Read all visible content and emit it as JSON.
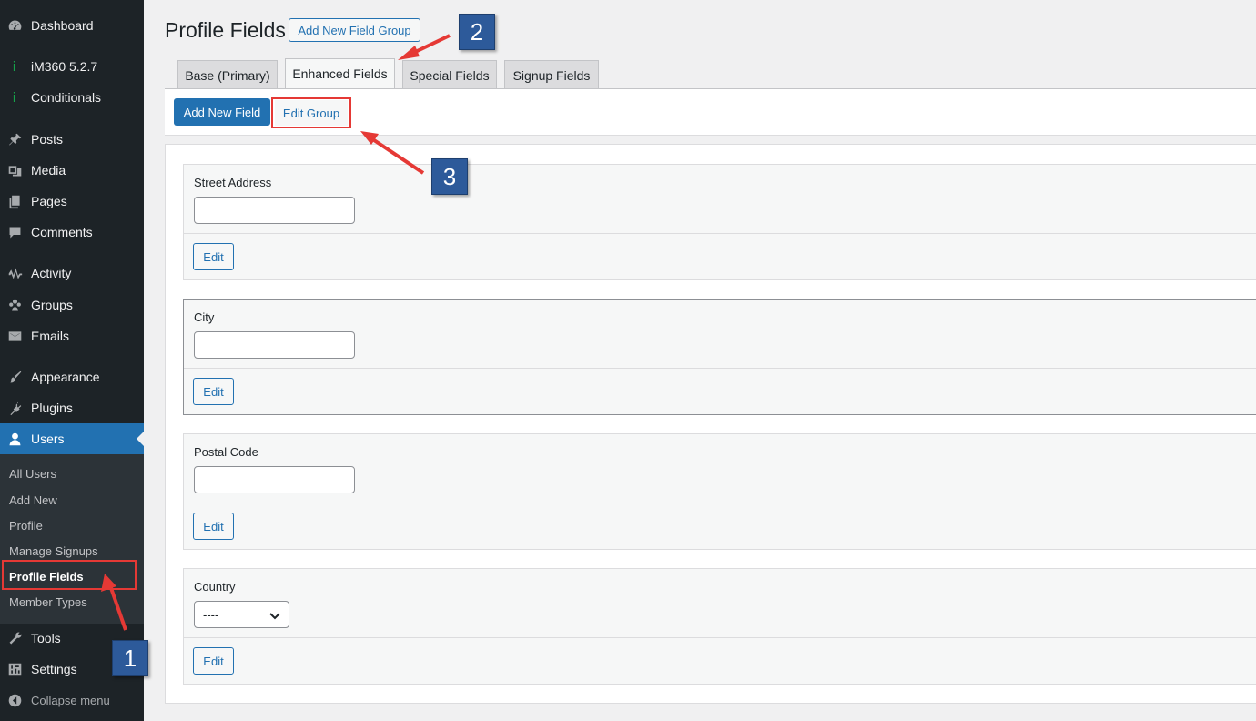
{
  "sidebar": {
    "items": [
      {
        "label": "Dashboard",
        "icon": "dashboard-icon"
      },
      {
        "label": "iM360 5.2.7",
        "icon": "info-icon"
      },
      {
        "label": "Conditionals",
        "icon": "info-icon"
      },
      {
        "label": "Posts",
        "icon": "pin-icon"
      },
      {
        "label": "Media",
        "icon": "media-icon"
      },
      {
        "label": "Pages",
        "icon": "pages-icon"
      },
      {
        "label": "Comments",
        "icon": "comments-icon"
      },
      {
        "label": "Activity",
        "icon": "activity-icon"
      },
      {
        "label": "Groups",
        "icon": "groups-icon"
      },
      {
        "label": "Emails",
        "icon": "email-icon"
      },
      {
        "label": "Appearance",
        "icon": "brush-icon"
      },
      {
        "label": "Plugins",
        "icon": "plugin-icon"
      },
      {
        "label": "Users",
        "icon": "user-icon"
      },
      {
        "label": "Tools",
        "icon": "wrench-icon"
      },
      {
        "label": "Settings",
        "icon": "settings-icon"
      },
      {
        "label": "Collapse menu",
        "icon": "collapse-icon"
      }
    ],
    "submenu": [
      "All Users",
      "Add New",
      "Profile",
      "Manage Signups",
      "Profile Fields",
      "Member Types"
    ],
    "info_glyph": "i"
  },
  "page": {
    "title": "Profile Fields",
    "add_group_label": "Add New Field Group"
  },
  "tabs": [
    "Base (Primary)",
    "Enhanced Fields",
    "Special Fields",
    "Signup Fields"
  ],
  "toolbar": {
    "add_field_label": "Add New Field",
    "edit_group_label": "Edit Group"
  },
  "fields": [
    {
      "label": "Street Address",
      "type": "text",
      "edit_label": "Edit"
    },
    {
      "label": "City",
      "type": "text",
      "edit_label": "Edit"
    },
    {
      "label": "Postal Code",
      "type": "text",
      "edit_label": "Edit"
    },
    {
      "label": "Country",
      "type": "select",
      "selected": "----",
      "edit_label": "Edit"
    }
  ],
  "annotations": {
    "badge_1": "1",
    "badge_2": "2",
    "badge_3": "3"
  },
  "colors": {
    "sidebar_bg": "#1d2327",
    "accent": "#2271b1",
    "annotation_red": "#e53935",
    "badge_blue": "#2d5a9a"
  }
}
